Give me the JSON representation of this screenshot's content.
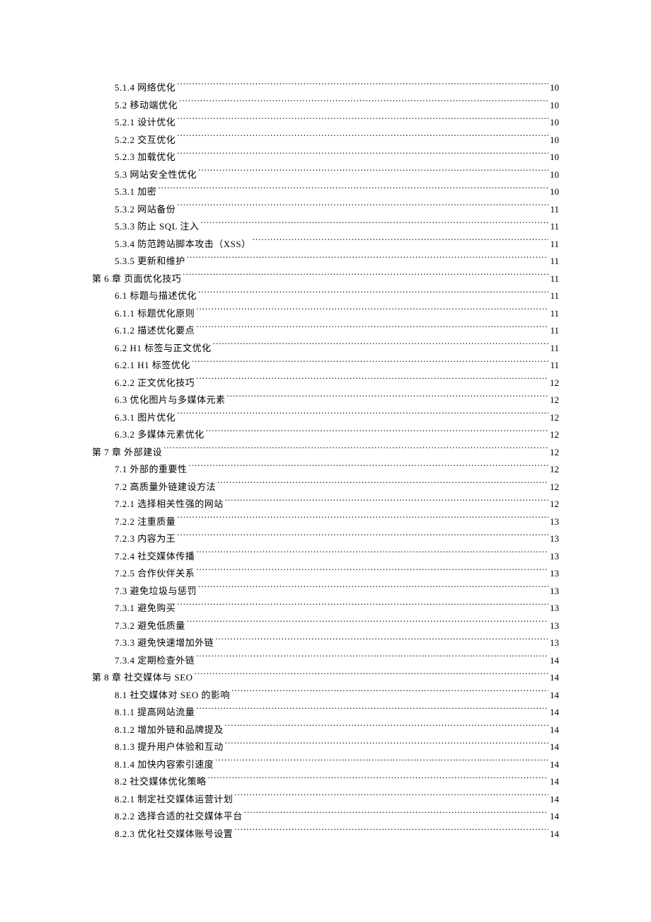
{
  "toc": [
    {
      "level": 1,
      "label": "5.1.4 网络优化 ",
      "page": "10"
    },
    {
      "level": 1,
      "label": "5.2 移动端优化 ",
      "page": "10"
    },
    {
      "level": 1,
      "label": "5.2.1 设计优化 ",
      "page": "10"
    },
    {
      "level": 1,
      "label": "5.2.2 交互优化 ",
      "page": "10"
    },
    {
      "level": 1,
      "label": "5.2.3 加载优化 ",
      "page": "10"
    },
    {
      "level": 1,
      "label": "5.3 网站安全性优化",
      "page": "10"
    },
    {
      "level": 1,
      "label": "5.3.1 加密 ",
      "page": "10"
    },
    {
      "level": 1,
      "label": "5.3.2 网站备份 ",
      "page": "11"
    },
    {
      "level": 1,
      "label": "5.3.3 防止 SQL 注入",
      "page": "11"
    },
    {
      "level": 1,
      "label": "5.3.4 防范跨站脚本攻击（XSS）",
      "page": "11"
    },
    {
      "level": 1,
      "label": "5.3.5 更新和维护",
      "page": "11"
    },
    {
      "level": 0,
      "label": "第 6 章 页面优化技巧",
      "page": "11"
    },
    {
      "level": 1,
      "label": "6.1 标题与描述优化",
      "page": "11"
    },
    {
      "level": 1,
      "label": "6.1.1 标题优化原则",
      "page": "11"
    },
    {
      "level": 1,
      "label": "6.1.2 描述优化要点",
      "page": "11"
    },
    {
      "level": 1,
      "label": "6.2 H1 标签与正文优化",
      "page": "11"
    },
    {
      "level": 1,
      "label": "6.2.1 H1 标签优化",
      "page": "11"
    },
    {
      "level": 1,
      "label": "6.2.2 正文优化技巧",
      "page": "12"
    },
    {
      "level": 1,
      "label": "6.3 优化图片与多媒体元素",
      "page": "12"
    },
    {
      "level": 1,
      "label": "6.3.1 图片优化 ",
      "page": "12"
    },
    {
      "level": 1,
      "label": "6.3.2 多媒体元素优化",
      "page": "12"
    },
    {
      "level": 0,
      "label": "第 7 章 外部建设 ",
      "page": "12"
    },
    {
      "level": 1,
      "label": "7.1 外部的重要性",
      "page": "12"
    },
    {
      "level": 1,
      "label": "7.2 高质量外链建设方法",
      "page": "12"
    },
    {
      "level": 1,
      "label": "7.2.1 选择相关性强的网站",
      "page": "12"
    },
    {
      "level": 1,
      "label": "7.2.2 注重质量 ",
      "page": "13"
    },
    {
      "level": 1,
      "label": "7.2.3 内容为王 ",
      "page": "13"
    },
    {
      "level": 1,
      "label": "7.2.4 社交媒体传播",
      "page": "13"
    },
    {
      "level": 1,
      "label": "7.2.5 合作伙伴关系",
      "page": "13"
    },
    {
      "level": 1,
      "label": "7.3 避免垃圾与惩罚",
      "page": "13"
    },
    {
      "level": 1,
      "label": "7.3.1 避免购买 ",
      "page": "13"
    },
    {
      "level": 1,
      "label": "7.3.2 避免低质量",
      "page": "13"
    },
    {
      "level": 1,
      "label": "7.3.3 避免快速增加外链",
      "page": "13"
    },
    {
      "level": 1,
      "label": "7.3.4 定期检查外链",
      "page": "14"
    },
    {
      "level": 0,
      "label": "第 8 章 社交媒体与 SEO",
      "page": "14"
    },
    {
      "level": 1,
      "label": "8.1 社交媒体对 SEO 的影响",
      "page": "14"
    },
    {
      "level": 1,
      "label": "8.1.1 提高网站流量",
      "page": "14"
    },
    {
      "level": 1,
      "label": "8.1.2 增加外链和品牌提及",
      "page": "14"
    },
    {
      "level": 1,
      "label": "8.1.3 提升用户体验和互动",
      "page": "14"
    },
    {
      "level": 1,
      "label": "8.1.4 加快内容索引速度",
      "page": "14"
    },
    {
      "level": 1,
      "label": "8.2 社交媒体优化策略",
      "page": "14"
    },
    {
      "level": 1,
      "label": "8.2.1 制定社交媒体运营计划",
      "page": "14"
    },
    {
      "level": 1,
      "label": "8.2.2 选择合适的社交媒体平台",
      "page": "14"
    },
    {
      "level": 1,
      "label": "8.2.3 优化社交媒体账号设置",
      "page": "14"
    }
  ]
}
